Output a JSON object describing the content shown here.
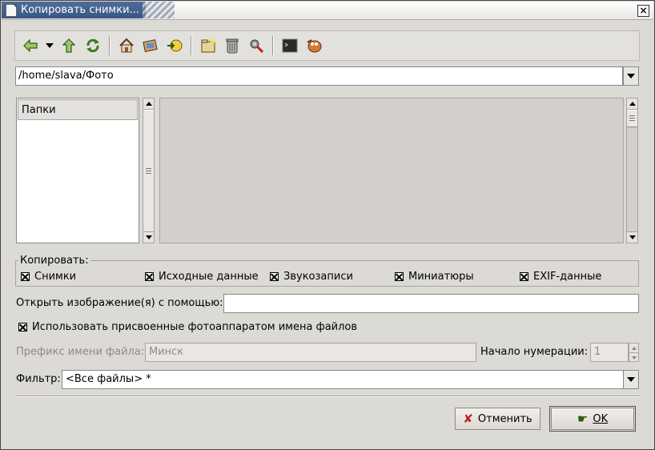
{
  "window": {
    "title": "Копировать снимки..."
  },
  "toolbar": {
    "icons": [
      "back-arrow-icon",
      "dropdown-icon",
      "up-arrow-icon",
      "refresh-icon",
      "home-icon",
      "album-icon",
      "goto-icon",
      "new-folder-icon",
      "trash-icon",
      "properties-icon",
      "terminal-icon",
      "gimp-icon"
    ]
  },
  "path": {
    "value": "/home/slava/Фото"
  },
  "folders": {
    "header": "Папки"
  },
  "copy_group": {
    "legend": "Копировать:",
    "options": [
      {
        "label": "Снимки",
        "checked": true
      },
      {
        "label": "Исходные данные",
        "checked": true
      },
      {
        "label": "Звукозаписи",
        "checked": true
      },
      {
        "label": "Миниатюры",
        "checked": true
      },
      {
        "label": "EXIF-данные",
        "checked": true
      }
    ]
  },
  "open_with": {
    "label": "Открыть изображение(я) с помощью:",
    "value": ""
  },
  "use_camera_names": {
    "label": "Использовать присвоенные фотоаппаратом имена файлов",
    "checked": true
  },
  "prefix": {
    "label": "Префикс имени файла:",
    "value": "Минск"
  },
  "numbering": {
    "label": "Начало нумерации:",
    "value": "1"
  },
  "filter": {
    "label": "Фильтр:",
    "value": "<Все файлы> *"
  },
  "buttons": {
    "cancel": "Отменить",
    "ok": "OK"
  }
}
